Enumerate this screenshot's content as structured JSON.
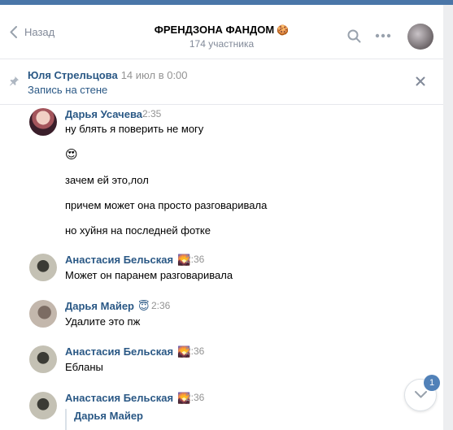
{
  "header": {
    "back_label": "Назад",
    "chat_name": "ФРЕНДЗОНА ФАНДОМ",
    "chat_emoji": "🍪",
    "member_count": "174 участника"
  },
  "pinned": {
    "author": "Юля Стрельцова",
    "date": "14 июл в 0:00",
    "link": "Запись на стене"
  },
  "messages": [
    {
      "author": "Дарья Усачева",
      "author_emoji": "",
      "time": "2:35",
      "lines": [
        "ну блять я поверить не могу",
        "😍",
        "зачем ей это,лол",
        "причем может она просто разговаривала",
        "но хуйня на последней фотке"
      ]
    },
    {
      "author": "Анастасия Бельская",
      "author_emoji": "🌄",
      "time": "2:36",
      "lines": [
        "Может он паранем разговаривала"
      ]
    },
    {
      "author": "Дарья Майер",
      "author_emoji": "😇",
      "time": "2:36",
      "lines": [
        "Удалите это пж"
      ]
    },
    {
      "author": "Анастасия Бельская",
      "author_emoji": "🌄",
      "time": "2:36",
      "lines": [
        "Ебланы"
      ]
    },
    {
      "author": "Анастасия Бельская",
      "author_emoji": "🌄",
      "time": "2:36",
      "reply_to": "Дарья Майер"
    }
  ],
  "scroll_badge": "1"
}
